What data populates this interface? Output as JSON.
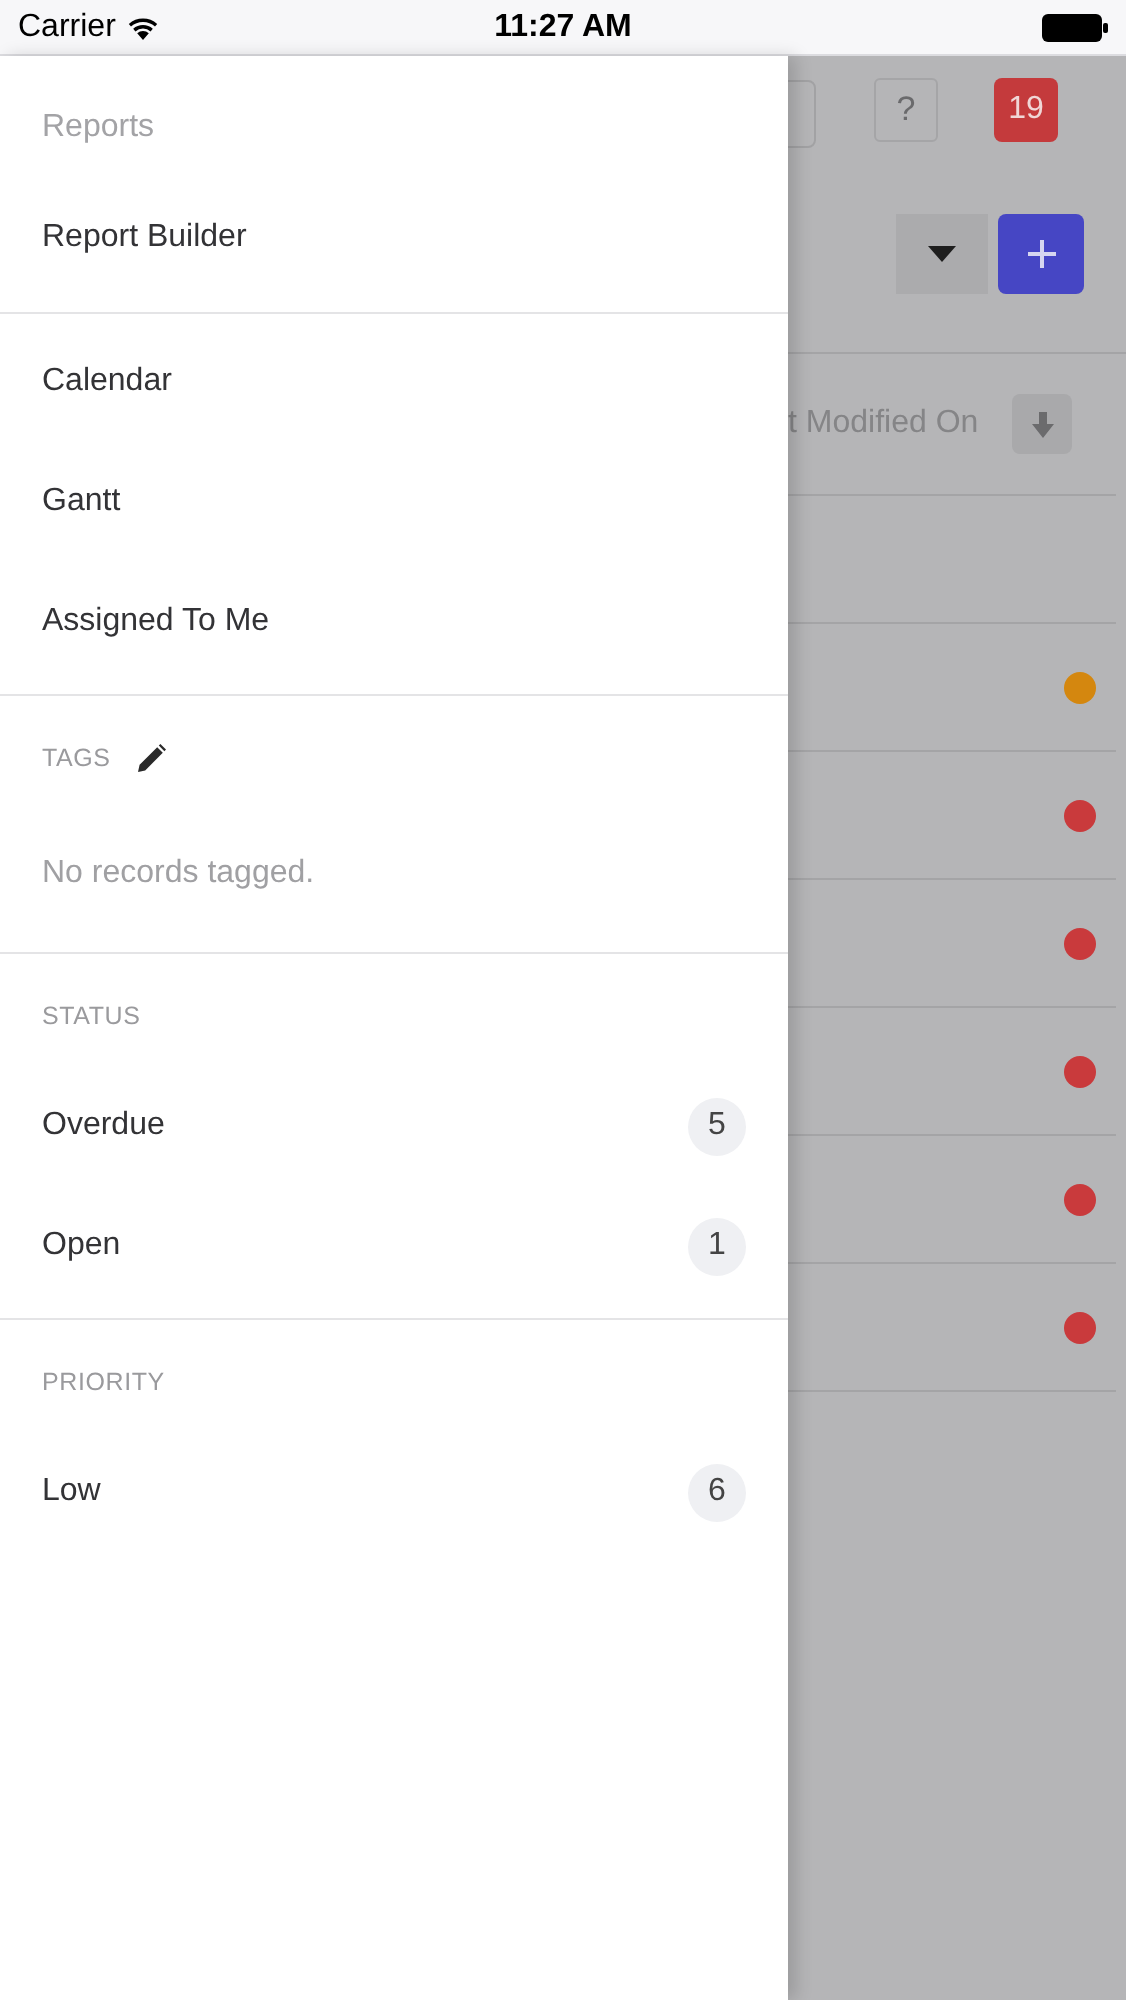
{
  "status_bar": {
    "carrier": "Carrier",
    "time": "11:27 AM"
  },
  "drawer": {
    "sections": [
      {
        "header": {
          "text": "Reports",
          "kind": "title"
        },
        "items": [
          {
            "label": "Report Builder"
          }
        ]
      },
      {
        "items": [
          {
            "label": "Calendar"
          },
          {
            "label": "Gantt"
          },
          {
            "label": "Assigned To Me"
          }
        ]
      },
      {
        "header": {
          "text": "TAGS",
          "kind": "caps",
          "editable": true
        },
        "empty_text": "No records tagged."
      },
      {
        "header": {
          "text": "STATUS",
          "kind": "caps"
        },
        "items": [
          {
            "label": "Overdue",
            "count": "5"
          },
          {
            "label": "Open",
            "count": "1"
          }
        ]
      },
      {
        "header": {
          "text": "PRIORITY",
          "kind": "caps"
        },
        "items": [
          {
            "label": "Low",
            "count": "6"
          }
        ]
      }
    ]
  },
  "background": {
    "help_button": "?",
    "notification_count": "19",
    "sort_column": "t Modified On",
    "rows": [
      {},
      {
        "color": "#d4870f"
      },
      {
        "color": "#c93a3c"
      },
      {
        "color": "#c93a3c"
      },
      {
        "color": "#c93a3c"
      },
      {
        "color": "#c93a3c"
      },
      {
        "color": "#c93a3c"
      }
    ]
  }
}
